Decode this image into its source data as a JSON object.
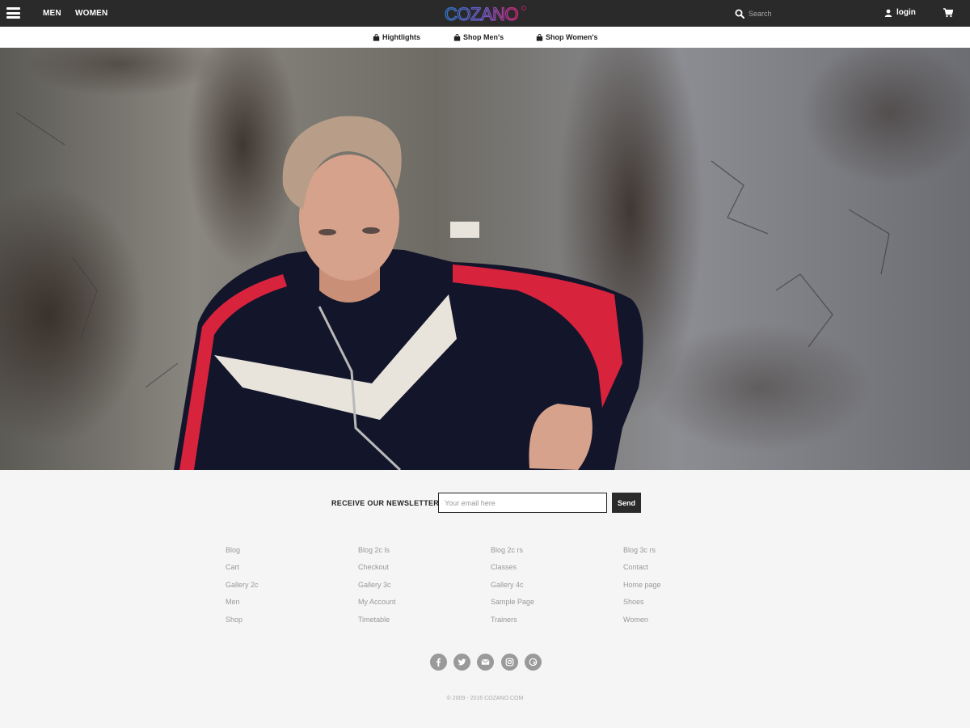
{
  "header": {
    "nav": [
      "MEN",
      "WOMEN"
    ],
    "logo_text": "COZANO",
    "search": {
      "placeholder": "Search",
      "value": ""
    },
    "login_label": "login"
  },
  "subnav": [
    {
      "label": "Hightlights",
      "icon": "shopping-bag-icon"
    },
    {
      "label": "Shop Men's",
      "icon": "shopping-bag-icon"
    },
    {
      "label": "Shop Women's",
      "icon": "shopping-bag-icon"
    }
  ],
  "newsletter": {
    "label": "RECEIVE OUR NEWSLETTER",
    "placeholder": "Your email here",
    "value": "",
    "button": "Send"
  },
  "footer_links": [
    [
      "Blog",
      "Cart",
      "Gallery 2c",
      "Men",
      "Shop"
    ],
    [
      "Blog 2c ls",
      "Checkout",
      "Gallery 3c",
      "My Account",
      "Timetable"
    ],
    [
      "Blog 2c rs",
      "Classes",
      "Gallery 4c",
      "Sample Page",
      "Trainers"
    ],
    [
      "Blog 3c rs",
      "Contact",
      "Home page",
      "Shoes",
      "Women"
    ]
  ],
  "social": [
    "facebook-icon",
    "twitter-icon",
    "envelope-icon",
    "instagram-icon",
    "google-plus-icon"
  ],
  "copyright": "© 2009 - 2016 COZANO.COM",
  "colors": {
    "topbar": "#2a2a2a",
    "logo_blue": "#2f7bd6",
    "logo_pink": "#e0237f",
    "footer_bg": "#f5f5f5",
    "link_gray": "#999999"
  }
}
